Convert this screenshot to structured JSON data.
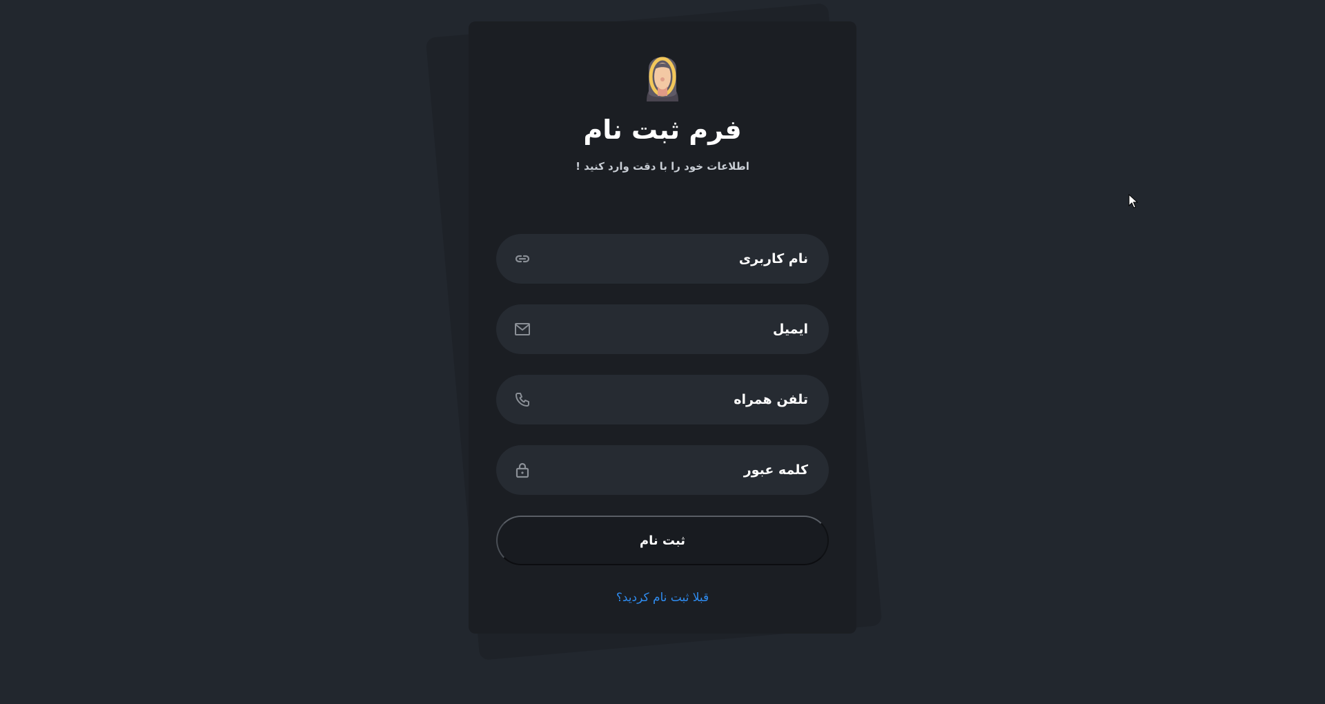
{
  "form": {
    "title": "فرم ثبت نام",
    "subtitle": "اطلاعات خود را با دقت وارد کنید !",
    "avatar_icon": "user-avatar-icon",
    "fields": [
      {
        "name": "username",
        "placeholder": "نام کاربری",
        "value": "",
        "icon": "link-icon",
        "type": "text"
      },
      {
        "name": "email",
        "placeholder": "ایمیل",
        "value": "",
        "icon": "mail-icon",
        "type": "email"
      },
      {
        "name": "phone",
        "placeholder": "تلفن همراه",
        "value": "",
        "icon": "phone-icon",
        "type": "tel"
      },
      {
        "name": "password",
        "placeholder": "کلمه عبور",
        "value": "",
        "icon": "lock-icon",
        "type": "password"
      }
    ],
    "submit_label": "ثبت نام",
    "login_link": "قبلا ثبت نام کردید؟"
  },
  "colors": {
    "page_background": "#22272e",
    "card_background": "#1b1e23",
    "field_background": "#262b32",
    "link": "#2f8cf0",
    "text": "#ffffff"
  }
}
